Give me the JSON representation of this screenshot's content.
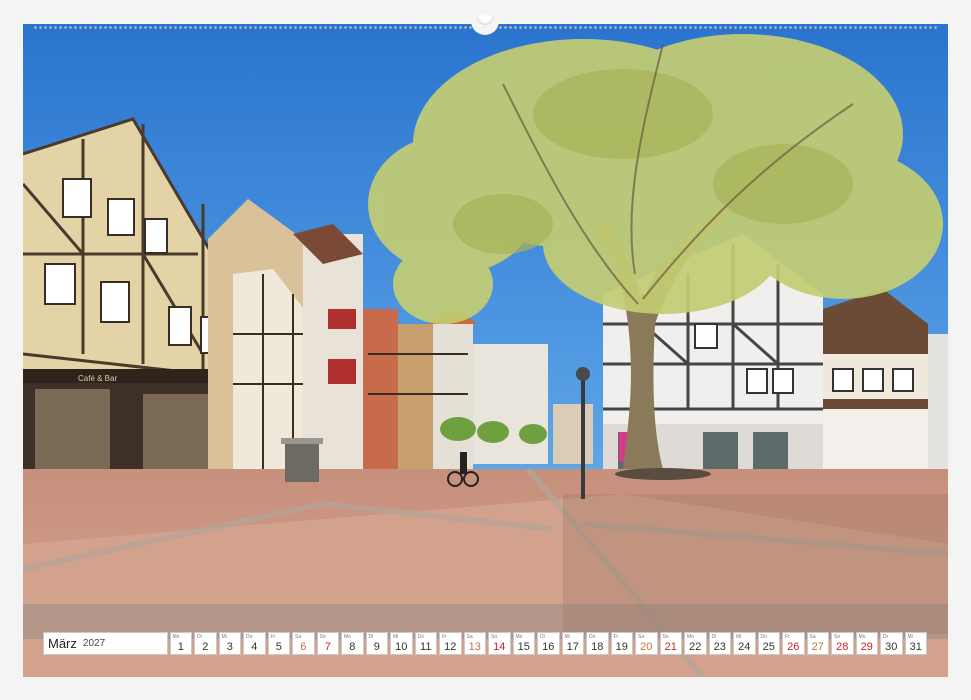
{
  "calendar": {
    "month": "März",
    "year": "2027",
    "days": [
      {
        "d": "1",
        "wd": "Mo",
        "type": "weekday"
      },
      {
        "d": "2",
        "wd": "Di",
        "type": "weekday"
      },
      {
        "d": "3",
        "wd": "Mi",
        "type": "weekday"
      },
      {
        "d": "4",
        "wd": "Do",
        "type": "weekday"
      },
      {
        "d": "5",
        "wd": "Fr",
        "type": "weekday"
      },
      {
        "d": "6",
        "wd": "Sa",
        "type": "sat"
      },
      {
        "d": "7",
        "wd": "So",
        "type": "sun"
      },
      {
        "d": "8",
        "wd": "Mo",
        "type": "weekday"
      },
      {
        "d": "9",
        "wd": "Di",
        "type": "weekday"
      },
      {
        "d": "10",
        "wd": "Mi",
        "type": "weekday"
      },
      {
        "d": "11",
        "wd": "Do",
        "type": "weekday"
      },
      {
        "d": "12",
        "wd": "Fr",
        "type": "weekday"
      },
      {
        "d": "13",
        "wd": "Sa",
        "type": "sat"
      },
      {
        "d": "14",
        "wd": "So",
        "type": "sun"
      },
      {
        "d": "15",
        "wd": "Mo",
        "type": "weekday"
      },
      {
        "d": "16",
        "wd": "Di",
        "type": "weekday"
      },
      {
        "d": "17",
        "wd": "Mi",
        "type": "weekday"
      },
      {
        "d": "18",
        "wd": "Do",
        "type": "weekday"
      },
      {
        "d": "19",
        "wd": "Fr",
        "type": "weekday"
      },
      {
        "d": "20",
        "wd": "Sa",
        "type": "sat"
      },
      {
        "d": "21",
        "wd": "So",
        "type": "sun"
      },
      {
        "d": "22",
        "wd": "Mo",
        "type": "weekday"
      },
      {
        "d": "23",
        "wd": "Di",
        "type": "weekday"
      },
      {
        "d": "24",
        "wd": "Mi",
        "type": "weekday"
      },
      {
        "d": "25",
        "wd": "Do",
        "type": "weekday"
      },
      {
        "d": "26",
        "wd": "Fr",
        "type": "sun"
      },
      {
        "d": "27",
        "wd": "Sa",
        "type": "sat"
      },
      {
        "d": "28",
        "wd": "So",
        "type": "sun"
      },
      {
        "d": "29",
        "wd": "Mo",
        "type": "sun"
      },
      {
        "d": "30",
        "wd": "Di",
        "type": "weekday"
      },
      {
        "d": "31",
        "wd": "Mi",
        "type": "weekday"
      }
    ]
  },
  "photo": {
    "shop_sign_left": "Café & Bar",
    "colors": {
      "sky": "#2f7fd6",
      "tree_foliage": "#c9d27a",
      "pavement": "#c98e7a",
      "timber": "#4a3a2c"
    }
  }
}
